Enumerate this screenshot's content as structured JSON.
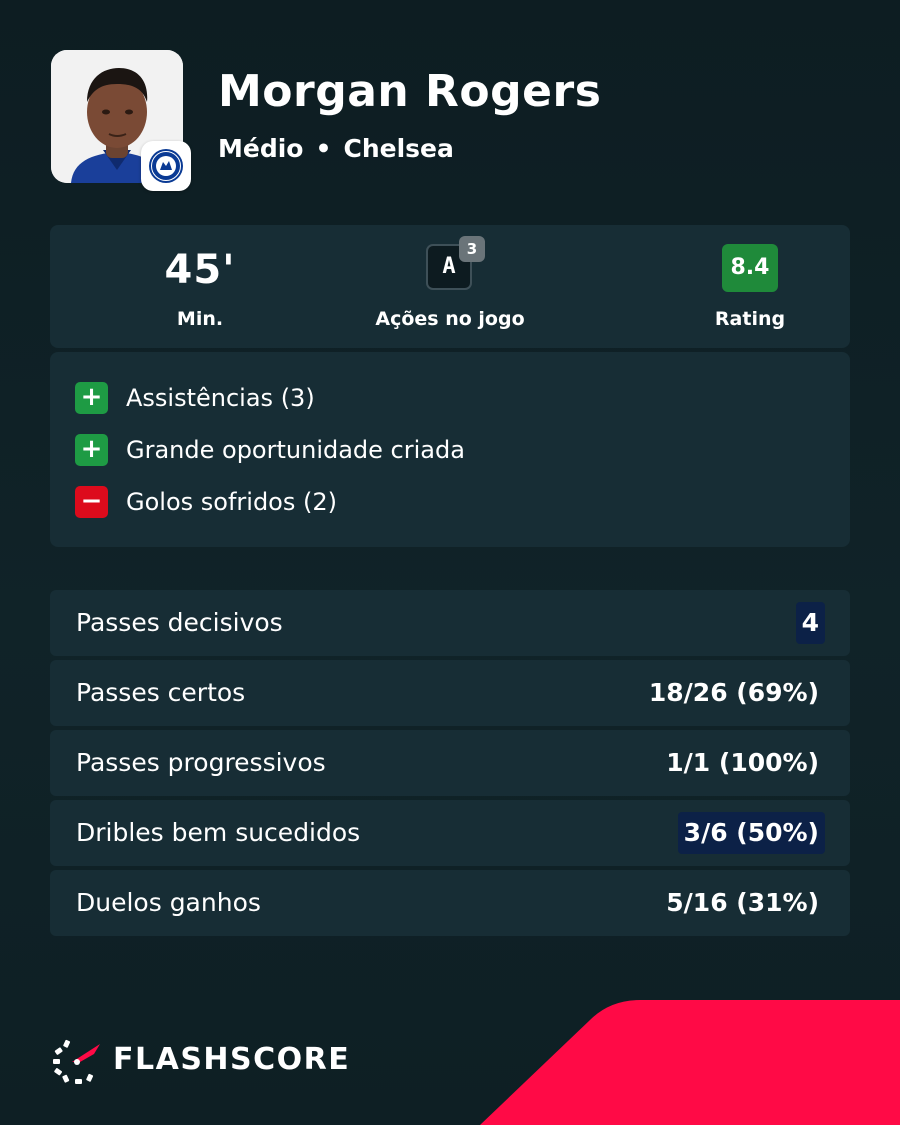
{
  "player": {
    "name": "Morgan Rogers",
    "position": "Médio",
    "separator": "•",
    "club": "Chelsea"
  },
  "summary": {
    "minutes_value": "45'",
    "minutes_label": "Min.",
    "actions_chip": "A",
    "actions_count": "3",
    "actions_label": "Ações no jogo",
    "rating_value": "8.4",
    "rating_label": "Rating"
  },
  "events": [
    {
      "sign": "+",
      "type": "positive",
      "text": "Assistências (3)"
    },
    {
      "sign": "+",
      "type": "positive",
      "text": "Grande oportunidade criada"
    },
    {
      "sign": "−",
      "type": "negative",
      "text": "Golos sofridos (2)"
    }
  ],
  "stats": [
    {
      "label": "Passes decisivos",
      "value": "4",
      "highlight": true
    },
    {
      "label": "Passes certos",
      "value": "18/26 (69%)",
      "highlight": false
    },
    {
      "label": "Passes progressivos",
      "value": "1/1 (100%)",
      "highlight": false
    },
    {
      "label": "Dribles bem sucedidos",
      "value": "3/6 (50%)",
      "highlight": true
    },
    {
      "label": "Duelos ganhos",
      "value": "5/16 (31%)",
      "highlight": false
    }
  ],
  "brand": {
    "name": "FLASHSCORE",
    "accent_color": "#ff0a46"
  },
  "colors": {
    "background": "#0f2026",
    "card": "#172d35",
    "positive": "#1e9b44",
    "negative": "#dd0b1c",
    "rating": "#1f8a3a",
    "highlight": "#0c2147"
  }
}
